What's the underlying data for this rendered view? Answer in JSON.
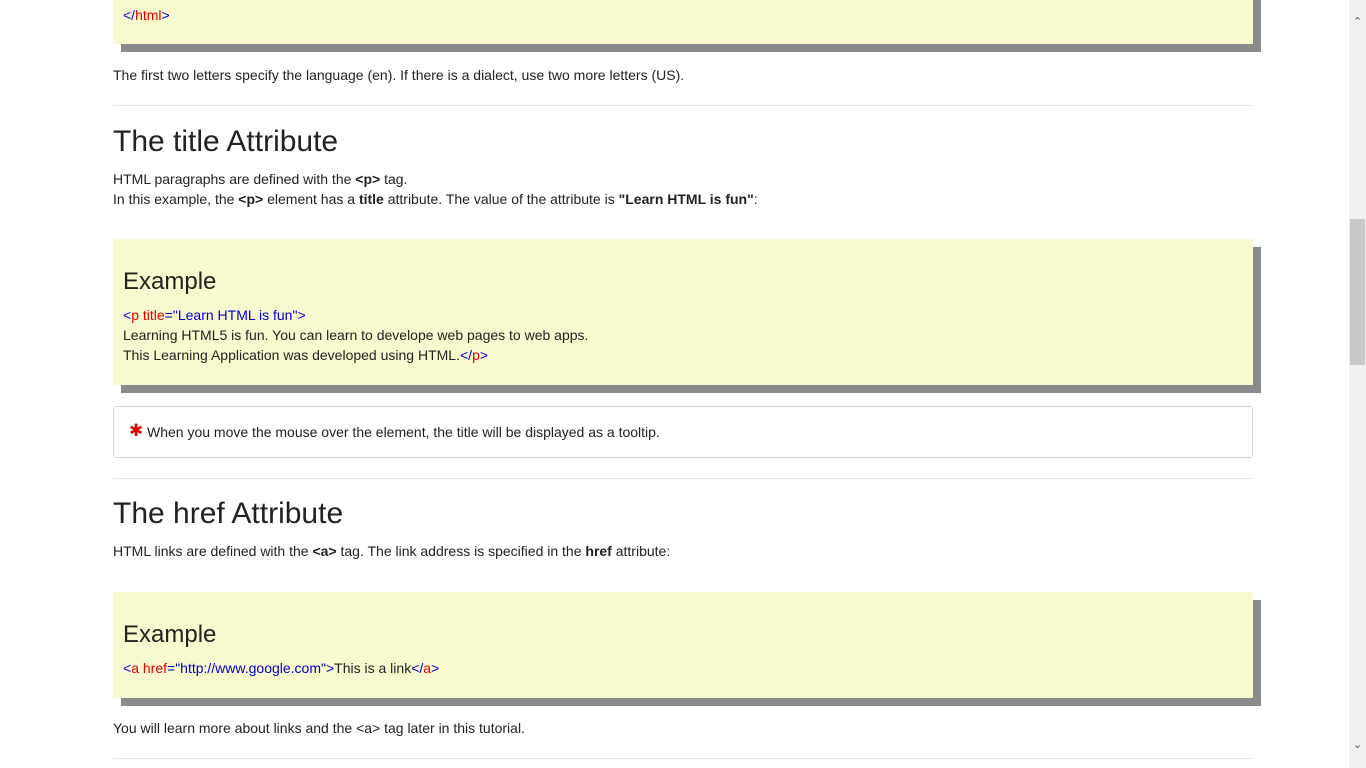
{
  "top_example": {
    "closing_tag_open": "</",
    "closing_tag_name": "html",
    "closing_tag_close": ">"
  },
  "lang_note": "The first two letters specify the language (en). If there is a dialect, use two more letters (US).",
  "title_section": {
    "heading": "The title Attribute",
    "line1_pre": "HTML paragraphs are defined with the ",
    "line1_bold": "<p>",
    "line1_post": " tag.",
    "line2_pre": "In this example, the ",
    "line2_bold1": "<p>",
    "line2_mid1": " element has a ",
    "line2_bold2": "title",
    "line2_mid2": " attribute. The value of the attribute is ",
    "line2_bold3": "\"Learn HTML is fun\"",
    "line2_post": ":",
    "example": {
      "label": "Example",
      "open_lt": "<",
      "open_tag": "p",
      "attr_name": " title",
      "eq": "=",
      "attr_value": "\"Learn HTML is fun\"",
      "open_gt": ">",
      "text1": "Learning HTML5 is fun. You can learn to develope web pages to web apps.",
      "text2": "This Learning Application was developed using HTML.",
      "close_lt": "</",
      "close_tag": "p",
      "close_gt": ">"
    },
    "note_icon": "✱",
    "note_text": "When you move the mouse over the element, the title will be displayed as a tooltip."
  },
  "href_section": {
    "heading": "The href Attribute",
    "line_pre": "HTML links are defined with the ",
    "line_bold1": "<a>",
    "line_mid": " tag. The link address is specified in the ",
    "line_bold2": "href",
    "line_post": " attribute:",
    "example": {
      "label": "Example",
      "open_lt": "<",
      "open_tag": "a",
      "attr_name": " href",
      "eq": "=",
      "attr_value": "\"http://www.google.com\"",
      "open_gt": ">",
      "text": "This is a link",
      "close_lt": "</",
      "close_tag": "a",
      "close_gt": ">"
    },
    "after": "You will learn more about links and the <a> tag later in this tutorial."
  },
  "scrollbar": {
    "up_icon": "⌃",
    "down_icon": "⌄"
  }
}
